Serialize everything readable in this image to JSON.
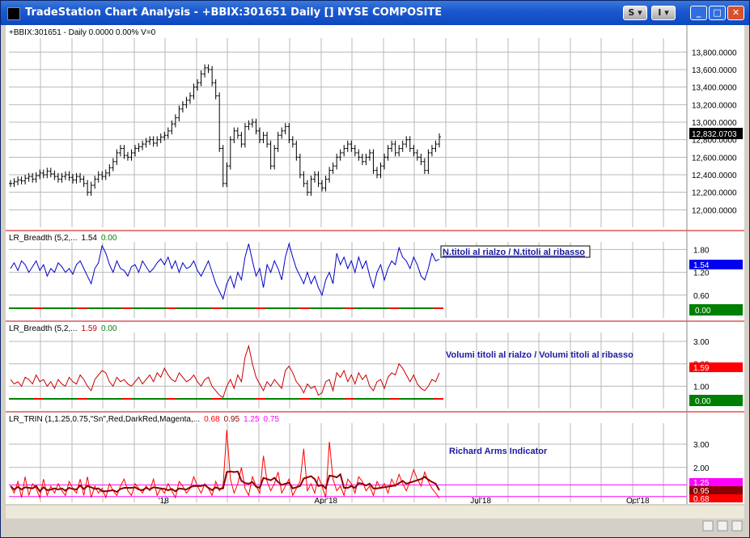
{
  "window": {
    "title": "TradeStation Chart Analysis - +BBIX:301651 Daily [] NYSE COMPOSITE",
    "btn_s": "S",
    "btn_i": "I",
    "btn_min": "_",
    "btn_max": "□",
    "btn_close": "✕"
  },
  "chart_data": [
    {
      "type": "bar",
      "panel": "price",
      "header": "+BBIX:301651 - Daily  0.0000  0.00%  V=0",
      "ylim": [
        11800,
        13960
      ],
      "y_ticks": [
        "13,800.0000",
        "13,600.0000",
        "13,400.0000",
        "13,200.0000",
        "13,000.0000",
        "12,800.0000",
        "12,600.0000",
        "12,400.0000",
        "12,200.0000",
        "12,000.0000"
      ],
      "y_tick_values": [
        13800,
        13600,
        13400,
        13200,
        13000,
        12800,
        12600,
        12400,
        12200,
        12000
      ],
      "last_value": "12,832.0703",
      "last_value_num": 12832,
      "closes": [
        12300,
        12320,
        12340,
        12330,
        12360,
        12380,
        12350,
        12390,
        12420,
        12400,
        12440,
        12410,
        12380,
        12350,
        12380,
        12400,
        12370,
        12340,
        12380,
        12350,
        12300,
        12200,
        12280,
        12350,
        12400,
        12380,
        12420,
        12480,
        12550,
        12650,
        12700,
        12620,
        12600,
        12650,
        12700,
        12720,
        12750,
        12780,
        12800,
        12760,
        12800,
        12830,
        12850,
        12900,
        12980,
        13050,
        13150,
        13200,
        13250,
        13300,
        13400,
        13450,
        13550,
        13620,
        13600,
        13450,
        13300,
        12700,
        12300,
        12500,
        12800,
        12900,
        12850,
        12750,
        12950,
        12980,
        13000,
        12900,
        12800,
        12850,
        12750,
        12500,
        12700,
        12850,
        12900,
        12950,
        12800,
        12750,
        12600,
        12400,
        12300,
        12200,
        12350,
        12400,
        12300,
        12250,
        12350,
        12450,
        12500,
        12600,
        12650,
        12700,
        12750,
        12700,
        12650,
        12600,
        12550,
        12600,
        12650,
        12450,
        12400,
        12500,
        12600,
        12700,
        12750,
        12650,
        12700,
        12750,
        12800,
        12700,
        12650,
        12600,
        12550,
        12450,
        12650,
        12700,
        12750,
        12832
      ],
      "x_ticks": [
        "'18",
        "Apr'18",
        "Jul'18",
        "Oct'18"
      ],
      "x_tick_positions": [
        0.23,
        0.46,
        0.69,
        0.92
      ]
    },
    {
      "type": "line",
      "panel": "breadth_count",
      "header": "LR_Breadth (5,2,...",
      "value1": "1.54",
      "value2": "0.00",
      "annotation": "N.titoli al rialzo / N.titoli al ribasso",
      "ylim": [
        0.0,
        2.0
      ],
      "y_ticks": [
        "1.80",
        "1.20",
        "0.60"
      ],
      "y_tick_values": [
        1.8,
        1.2,
        0.6
      ],
      "last_value": "1.54",
      "last_value_num": 1.54,
      "zero_label": "0.00",
      "values": [
        1.3,
        1.45,
        1.25,
        1.5,
        1.4,
        1.2,
        1.35,
        1.5,
        1.25,
        1.4,
        1.1,
        1.3,
        1.2,
        1.45,
        1.35,
        1.2,
        1.3,
        1.15,
        1.4,
        1.5,
        1.3,
        1.1,
        0.9,
        1.3,
        1.45,
        1.9,
        1.7,
        1.4,
        1.2,
        1.5,
        1.3,
        1.25,
        1.1,
        1.35,
        1.4,
        1.2,
        1.5,
        1.35,
        1.2,
        1.3,
        1.45,
        1.55,
        1.4,
        1.6,
        1.3,
        1.5,
        1.2,
        1.45,
        1.3,
        1.35,
        1.5,
        1.25,
        1.1,
        1.3,
        1.5,
        1.2,
        0.9,
        0.7,
        0.5,
        0.9,
        1.1,
        0.8,
        1.2,
        1.0,
        1.6,
        1.95,
        1.5,
        1.1,
        1.3,
        0.8,
        1.4,
        1.2,
        1.5,
        1.3,
        1.0,
        1.6,
        1.95,
        1.6,
        1.3,
        1.1,
        0.9,
        1.2,
        0.9,
        1.1,
        0.8,
        0.6,
        1.0,
        1.2,
        0.9,
        1.7,
        1.4,
        1.6,
        1.3,
        1.5,
        1.2,
        1.6,
        1.3,
        1.5,
        1.1,
        0.8,
        1.2,
        1.4,
        1.0,
        1.3,
        1.5,
        1.4,
        1.85,
        1.6,
        1.5,
        1.3,
        1.6,
        1.4,
        1.1,
        1.0,
        1.3,
        1.7,
        1.5,
        1.54
      ]
    },
    {
      "type": "line",
      "panel": "breadth_volume",
      "header": "LR_Breadth (5,2,...",
      "value1": "1.59",
      "value2": "0.00",
      "annotation": "Volumi titoli al rialzo / Volumi titoli al ribasso",
      "ylim": [
        0.0,
        3.4
      ],
      "y_ticks": [
        "3.00",
        "2.00",
        "1.00"
      ],
      "y_tick_values": [
        3.0,
        2.0,
        1.0
      ],
      "last_value": "1.59",
      "last_value_num": 1.59,
      "zero_label": "0.00",
      "values": [
        1.3,
        1.1,
        1.2,
        1.0,
        1.4,
        1.3,
        1.1,
        1.5,
        1.2,
        1.3,
        1.0,
        1.2,
        0.9,
        1.3,
        1.1,
        1.0,
        1.4,
        1.2,
        1.1,
        1.5,
        1.3,
        1.0,
        0.8,
        1.3,
        1.5,
        1.7,
        1.6,
        1.2,
        1.0,
        1.4,
        1.2,
        1.3,
        1.1,
        1.0,
        1.2,
        1.4,
        1.1,
        1.3,
        1.5,
        1.2,
        1.6,
        1.4,
        1.8,
        1.5,
        1.3,
        1.2,
        1.6,
        1.4,
        1.2,
        1.3,
        1.5,
        1.2,
        1.0,
        1.3,
        1.4,
        1.0,
        0.8,
        0.6,
        0.5,
        1.0,
        1.3,
        0.9,
        1.5,
        1.2,
        2.3,
        2.8,
        2.0,
        1.4,
        1.1,
        0.8,
        1.2,
        1.0,
        1.3,
        1.1,
        0.9,
        1.7,
        1.9,
        1.6,
        1.2,
        1.0,
        0.7,
        1.1,
        0.9,
        1.0,
        0.6,
        0.7,
        1.2,
        1.3,
        0.8,
        1.6,
        1.4,
        1.7,
        1.2,
        1.5,
        1.1,
        1.6,
        1.3,
        1.5,
        1.0,
        0.8,
        1.2,
        1.3,
        0.9,
        1.4,
        1.6,
        1.5,
        2.0,
        1.8,
        1.5,
        1.2,
        1.5,
        1.1,
        0.9,
        0.8,
        1.0,
        1.3,
        1.2,
        1.59
      ]
    },
    {
      "type": "line",
      "panel": "trin",
      "header": "LR_TRIN (1,1.25,0.75,\"Sn\",Red,DarkRed,Magenta,...",
      "value1": "0.68",
      "value2": "0.95",
      "value3": "1.25",
      "value4": "0.75",
      "annotation": "Richard Arms Indicator",
      "ylim": [
        0.5,
        3.9
      ],
      "y_ticks": [
        "3.00",
        "2.00"
      ],
      "y_tick_values": [
        3.0,
        2.0
      ],
      "labels": [
        "1.25",
        "0.95",
        "0.68"
      ],
      "label_values": [
        1.25,
        0.95,
        0.68
      ],
      "colors": {
        "raw": "#ff0000",
        "smooth": "#8b0000",
        "band": "#ff00ff",
        "label_top": "#ff00ff",
        "label_mid": "#8b0000",
        "label_bot": "#ff0000"
      },
      "values": [
        1.2,
        0.9,
        1.4,
        0.7,
        1.6,
        0.8,
        1.3,
        1.1,
        0.7,
        1.5,
        0.8,
        1.2,
        0.9,
        1.3,
        1.0,
        0.8,
        1.4,
        1.1,
        0.9,
        1.5,
        0.8,
        1.6,
        0.7,
        1.2,
        0.9,
        1.1,
        0.7,
        1.3,
        1.0,
        0.8,
        1.2,
        1.5,
        1.0,
        0.8,
        1.3,
        1.1,
        0.9,
        1.2,
        1.0,
        1.5,
        0.8,
        1.1,
        0.9,
        1.3,
        1.0,
        0.7,
        1.4,
        1.2,
        0.9,
        1.1,
        1.6,
        1.2,
        0.9,
        1.3,
        1.1,
        0.8,
        1.4,
        1.0,
        1.2,
        3.6,
        1.5,
        0.9,
        1.3,
        2.0,
        1.1,
        0.8,
        1.6,
        1.2,
        0.9,
        2.5,
        1.4,
        1.0,
        1.3,
        1.8,
        0.9,
        1.2,
        1.5,
        0.8,
        1.1,
        1.4,
        2.8,
        1.0,
        1.3,
        0.9,
        1.6,
        1.2,
        0.7,
        3.1,
        1.5,
        1.0,
        1.2,
        0.8,
        1.5,
        1.3,
        0.9,
        1.6,
        1.4,
        1.0,
        1.2,
        0.8,
        1.4,
        1.1,
        1.3,
        0.9,
        1.5,
        1.2,
        1.7,
        1.3,
        1.0,
        1.4,
        1.9,
        1.5,
        1.2,
        1.8,
        1.4,
        1.1,
        0.9,
        0.68
      ]
    }
  ]
}
